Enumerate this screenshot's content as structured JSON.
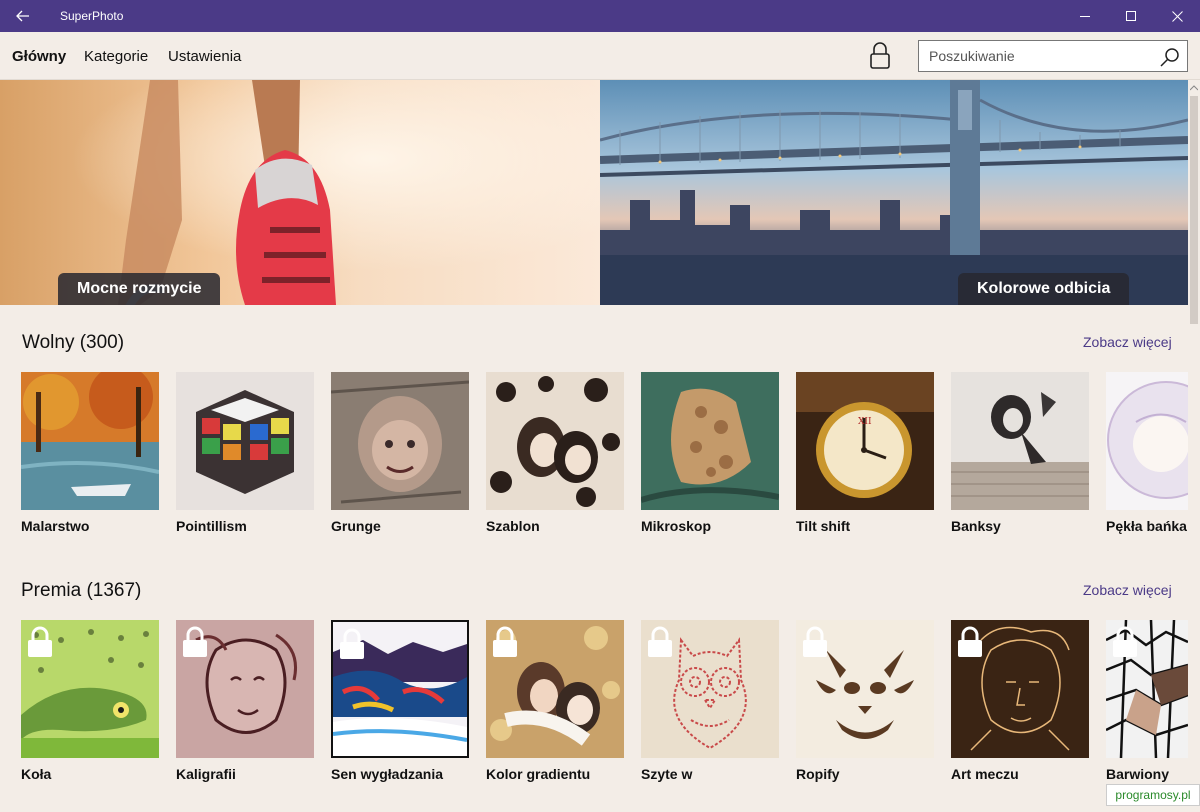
{
  "window": {
    "title": "SuperPhoto"
  },
  "nav": {
    "items": [
      {
        "label": "Główny",
        "active": true
      },
      {
        "label": "Kategorie",
        "active": false
      },
      {
        "label": "Ustawienia",
        "active": false
      }
    ],
    "search_placeholder": "Poszukiwanie"
  },
  "hero": {
    "left_label": "Mocne rozmycie",
    "right_label": "Kolorowe odbicia"
  },
  "free": {
    "title": "Wolny (300)",
    "see_more": "Zobacz więcej",
    "items": [
      "Malarstwo",
      "Pointillism",
      "Grunge",
      "Szablon",
      "Mikroskop",
      "Tilt shift",
      "Banksy",
      "Pękła bańka"
    ]
  },
  "premium": {
    "title": "Premia (1367)",
    "see_more": "Zobacz więcej",
    "items": [
      "Koła",
      "Kaligrafii",
      "Sen wygładzania",
      "Kolor gradientu",
      "Szyte w",
      "Ropify",
      "Art meczu",
      "Barwiony"
    ]
  },
  "watermark": "programosy.pl",
  "colors": {
    "titlebar": "#4b3a87",
    "accent": "#4b3a87",
    "background": "#f3ede7"
  }
}
